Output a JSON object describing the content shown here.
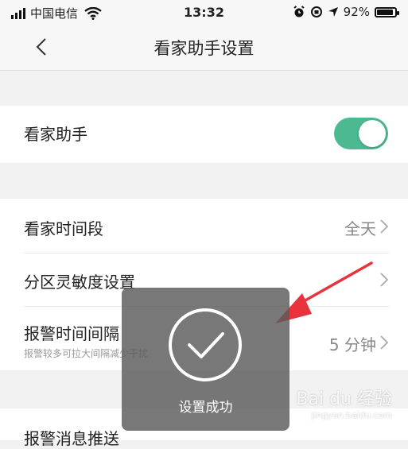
{
  "status_bar": {
    "carrier": "中国电信",
    "time": "13:32",
    "battery": "92%",
    "battery_level": 0.92
  },
  "nav": {
    "title": "看家助手设置"
  },
  "settings": {
    "assistant": {
      "label": "看家助手",
      "enabled": true
    },
    "time_period": {
      "label": "看家时间段",
      "value": "全天"
    },
    "zone_sensitivity": {
      "label": "分区灵敏度设置"
    },
    "alarm_interval": {
      "label": "报警时间间隔",
      "hint": "报警较多可拉大间隔减少干扰",
      "value": "5 分钟"
    },
    "push": {
      "label": "报警消息推送"
    }
  },
  "toast": {
    "text": "设置成功"
  },
  "watermark": {
    "brand": "Bai du 经验",
    "url": "jingyan.baidu.com"
  },
  "colors": {
    "toggle_on": "#4cb990",
    "annotation_arrow": "#e8323c"
  }
}
